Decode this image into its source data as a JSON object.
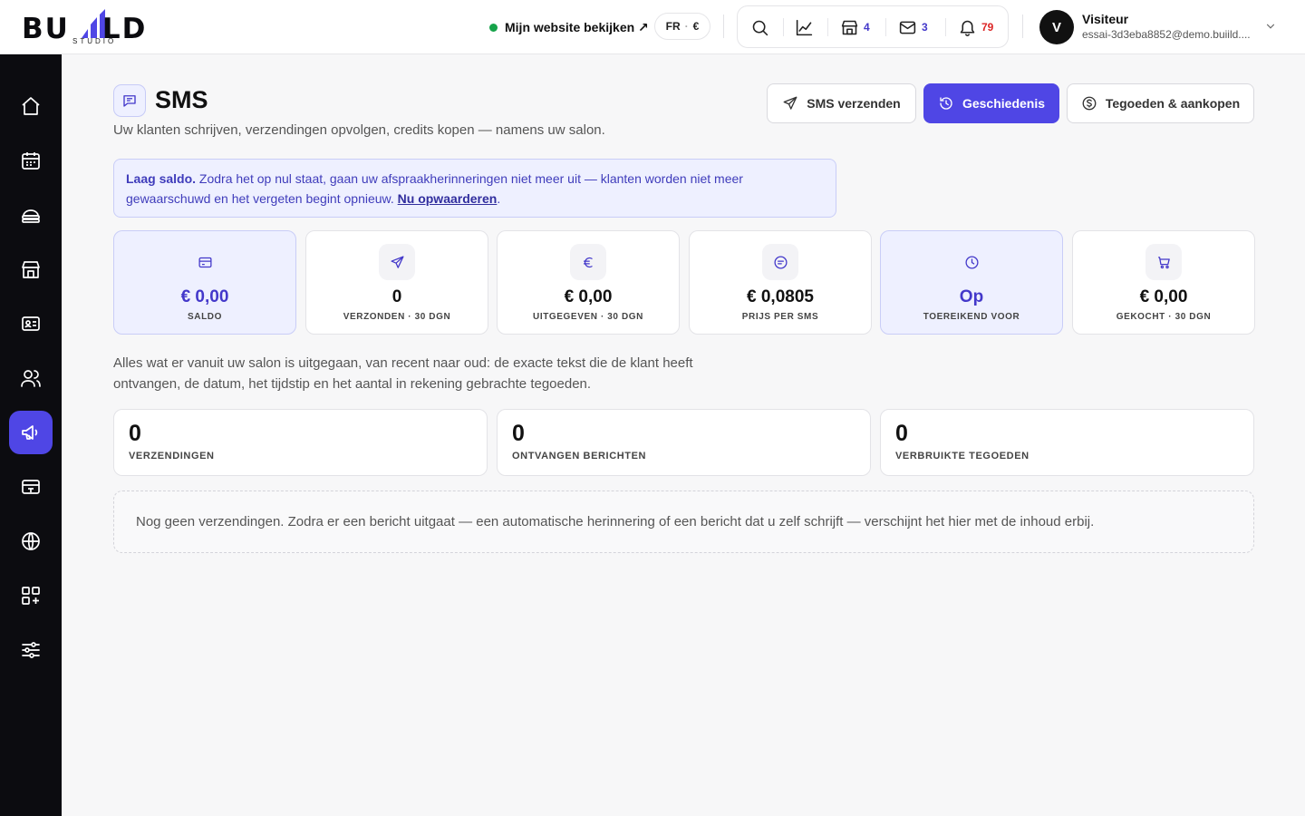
{
  "brand": {
    "logo_text": "BUIILD",
    "logo_sub": "STUDIO"
  },
  "header": {
    "site_link": "Mijn website bekijken ↗",
    "lang": "FR",
    "currency": "€",
    "icons": [
      {
        "name": "search-icon"
      },
      {
        "name": "analytics-icon"
      },
      {
        "name": "store-icon",
        "count": "4"
      },
      {
        "name": "mail-icon",
        "count": "3"
      },
      {
        "name": "bell-icon",
        "count": "79"
      }
    ],
    "user": {
      "avatar": "V",
      "name": "Visiteur",
      "email": "essai-3d3eba8852@demo.buiild...."
    }
  },
  "sidebar": {
    "items": [
      {
        "name": "home-icon",
        "active": false
      },
      {
        "name": "calendar-icon",
        "active": false
      },
      {
        "name": "service-icon",
        "active": false
      },
      {
        "name": "storefront-icon",
        "active": false
      },
      {
        "name": "id-card-icon",
        "active": false
      },
      {
        "name": "users-icon",
        "active": false
      },
      {
        "name": "megaphone-icon",
        "active": true
      },
      {
        "name": "payment-icon",
        "active": false
      },
      {
        "name": "globe-icon",
        "active": false
      },
      {
        "name": "apps-icon",
        "active": false
      },
      {
        "name": "sliders-icon",
        "active": false
      }
    ]
  },
  "page": {
    "title": "SMS",
    "subtitle": "Uw klanten schrijven, verzendingen opvolgen, credits kopen — namens uw salon.",
    "buttons": {
      "send": "SMS verzenden",
      "history": "Geschiedenis",
      "credits": "Tegoeden & aankopen"
    }
  },
  "alert": {
    "strong": "Laag saldo.",
    "text": " Zodra het op nul staat, gaan uw afspraakherinneringen niet meer uit — klanten worden niet meer gewaarschuwd en het vergeten begint opnieuw. ",
    "link": "Nu opwaarderen",
    "end": "."
  },
  "stats": [
    {
      "value": "€ 0,00",
      "label": "SALDO",
      "icon": "credit-card-icon",
      "highlight": true
    },
    {
      "value": "0",
      "label": "VERZONDEN · 30 DGN",
      "icon": "send-icon",
      "highlight": false
    },
    {
      "value": "€ 0,00",
      "label": "UITGEGEVEN · 30 DGN",
      "icon": "euro-icon",
      "highlight": false
    },
    {
      "value": "€ 0,0805",
      "label": "PRIJS PER SMS",
      "icon": "message-icon",
      "highlight": false
    },
    {
      "value": "Op",
      "label": "TOEREIKEND VOOR",
      "icon": "clock-icon",
      "highlight": true
    },
    {
      "value": "€ 0,00",
      "label": "GEKOCHT · 30 DGN",
      "icon": "cart-icon",
      "highlight": false
    }
  ],
  "history": {
    "description": "Alles wat er vanuit uw salon is uitgegaan, van recent naar oud: de exacte tekst die de klant heeft ontvangen, de datum, het tijdstip en het aantal in rekening gebrachte tegoeden.",
    "counts": [
      {
        "value": "0",
        "label": "VERZENDINGEN"
      },
      {
        "value": "0",
        "label": "ONTVANGEN BERICHTEN"
      },
      {
        "value": "0",
        "label": "VERBRUIKTE TEGOEDEN"
      }
    ],
    "empty": "Nog geen verzendingen. Zodra er een bericht uitgaat — een automatische herinnering of een bericht dat u zelf schrijft — verschijnt het hier met de inhoud erbij."
  },
  "colors": {
    "accent": "#4f46e5",
    "sidebar": "#0c0c10",
    "online": "#16a34a",
    "badge_red": "#dc2626"
  }
}
